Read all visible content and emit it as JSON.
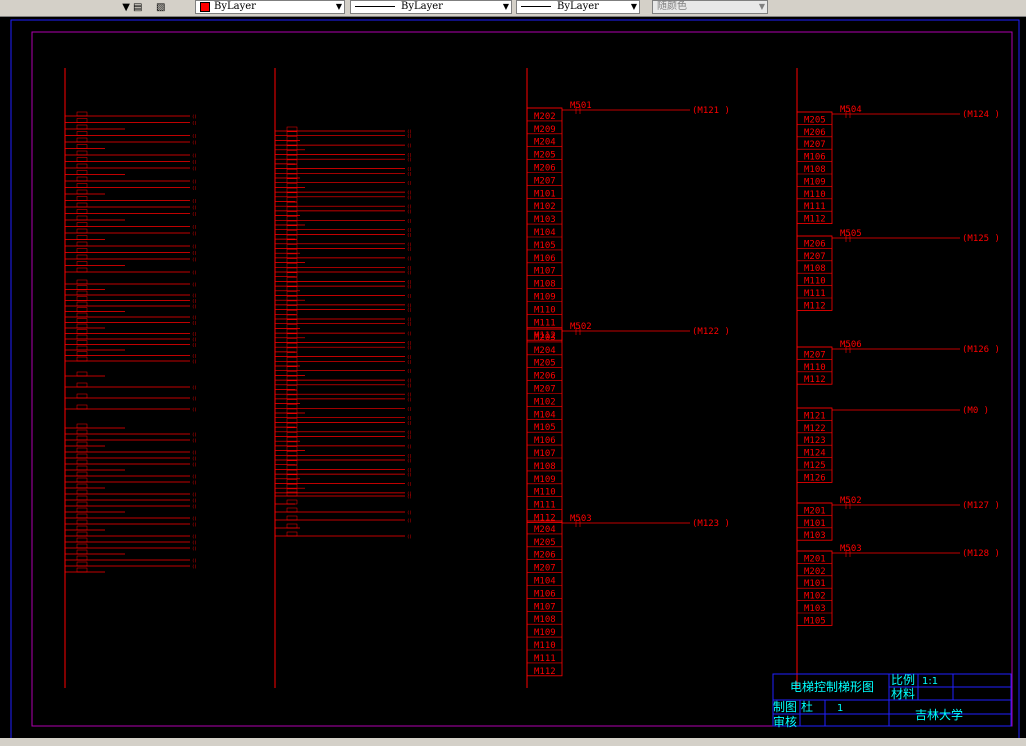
{
  "toolbar": {
    "color_label": "ByLayer",
    "linetype_label": "ByLayer",
    "lineweight_label": "ByLayer",
    "plotstyle_label": "随颜色"
  },
  "drawing": {
    "col3": {
      "rungs": [
        {
          "out": "M501",
          "coil": "M121",
          "contacts": [
            "M202",
            "M209",
            "M204",
            "M205",
            "M206",
            "M207",
            "M101",
            "M102",
            "M103",
            "M104",
            "M105",
            "M106",
            "M107",
            "M108",
            "M109",
            "M110",
            "M111",
            "M112"
          ]
        },
        {
          "out": "M502",
          "coil": "M122",
          "contacts": [
            "M203",
            "M204",
            "M205",
            "M206",
            "M207",
            "M102",
            "M104",
            "M105",
            "M106",
            "M107",
            "M108",
            "M109",
            "M110",
            "M111",
            "M112"
          ]
        },
        {
          "out": "M503",
          "coil": "M123",
          "contacts": [
            "M204",
            "M205",
            "M206",
            "M207",
            "M104",
            "M106",
            "M107",
            "M108",
            "M109",
            "M110",
            "M111",
            "M112"
          ]
        }
      ]
    },
    "col4": {
      "rungs": [
        {
          "out": "M504",
          "coil": "M124",
          "contacts": [
            "M205",
            "M206",
            "M207",
            "M106",
            "M108",
            "M109",
            "M110",
            "M111",
            "M112"
          ]
        },
        {
          "out": "M505",
          "coil": "M125",
          "contacts": [
            "M206",
            "M207",
            "M108",
            "M110",
            "M111",
            "M112"
          ]
        },
        {
          "out": "M506",
          "coil": "M126",
          "contacts": [
            "M207",
            "M110",
            "M112"
          ]
        },
        {
          "out": "",
          "coil": "M0",
          "contacts": [
            "M121",
            "M122",
            "M123",
            "M124",
            "M125",
            "M126"
          ]
        },
        {
          "out": "M502",
          "coil": "M127",
          "contacts": [
            "M201",
            "M101",
            "M103"
          ]
        },
        {
          "out": "M503",
          "coil": "M128",
          "contacts": [
            "M201",
            "M202",
            "M101",
            "M102",
            "M103",
            "M105"
          ]
        }
      ]
    },
    "title_block": {
      "title": "电梯控制梯形图",
      "scale_label": "比例",
      "scale_value": "1:1",
      "material_label": "材料",
      "drawn_label": "制图",
      "drawn_by": "杜",
      "drawn_value": "1",
      "check_label": "审核",
      "org": "吉林大学"
    }
  },
  "colors": {
    "ladder": "#ff0000",
    "frame": "#b000b0",
    "outer_frame": "#2020ff",
    "title_block_text": "#00ffff"
  }
}
